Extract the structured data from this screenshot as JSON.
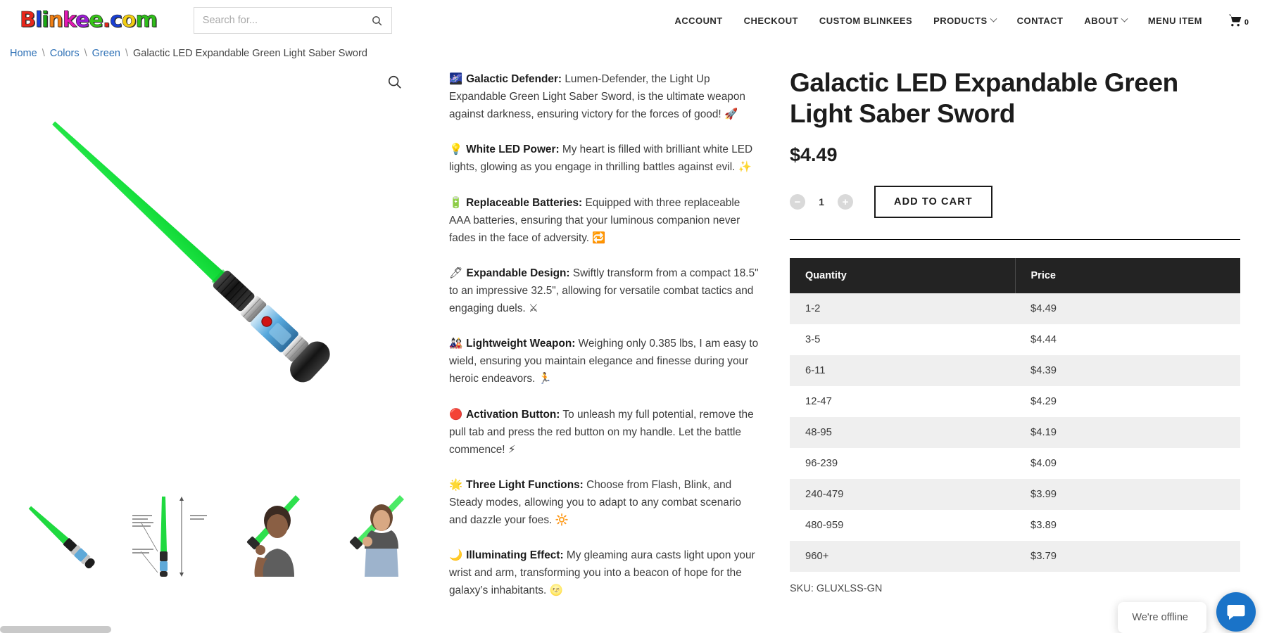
{
  "brand": {
    "name": "Blinkee.com",
    "letters": [
      {
        "ch": "B",
        "color": "#e8271c"
      },
      {
        "ch": "l",
        "color": "#1a3fd4"
      },
      {
        "ch": "i",
        "color": "#1aa814"
      },
      {
        "ch": "n",
        "color": "#f07f14"
      },
      {
        "ch": "k",
        "color": "#e318b4"
      },
      {
        "ch": "e",
        "color": "#9b1ad4"
      },
      {
        "ch": "e",
        "color": "#36c417"
      },
      {
        "ch": ".",
        "color": "#e8271c"
      },
      {
        "ch": "c",
        "color": "#1a3fd4"
      },
      {
        "ch": "o",
        "color": "#f2cd12"
      },
      {
        "ch": "m",
        "color": "#2fbe1a"
      }
    ]
  },
  "search": {
    "placeholder": "Search for...",
    "value": "",
    "icon": "search-icon"
  },
  "nav": {
    "items": [
      {
        "label": "ACCOUNT",
        "has_dropdown": false
      },
      {
        "label": "CHECKOUT",
        "has_dropdown": false
      },
      {
        "label": "CUSTOM BLINKEES",
        "has_dropdown": false
      },
      {
        "label": "PRODUCTS",
        "has_dropdown": true
      },
      {
        "label": "CONTACT",
        "has_dropdown": false
      },
      {
        "label": "ABOUT",
        "has_dropdown": true
      },
      {
        "label": "MENU ITEM",
        "has_dropdown": false
      }
    ],
    "cart": {
      "icon": "shopping-cart-icon",
      "count": "0"
    }
  },
  "breadcrumb": {
    "items": [
      "Home",
      "Colors",
      "Green"
    ],
    "separator": "\\",
    "current": "Galactic LED Expandable Green Light Saber Sword"
  },
  "gallery": {
    "zoom_icon": "magnifier-icon",
    "main_alt": "Green light saber sword with black and silver handle",
    "thumbnails": [
      {
        "alt": "Green light saber sword diagonal"
      },
      {
        "alt": "Light saber dimension diagram with measurements"
      },
      {
        "alt": "Boy holding green light saber"
      },
      {
        "alt": "Girl holding green light saber"
      }
    ]
  },
  "description": {
    "paragraphs": [
      {
        "emoji": "🌌",
        "heading": "Galactic Defender:",
        "text": " Lumen-Defender, the Light Up Expandable Green Light Saber Sword, is the ultimate weapon against darkness, ensuring victory for the forces of good! ",
        "trailing_emoji": "🚀"
      },
      {
        "emoji": "💡",
        "heading": "White LED Power:",
        "text": " My heart is filled with brilliant white LED lights, glowing as you engage in thrilling battles against evil. ",
        "trailing_emoji": "✨"
      },
      {
        "emoji": "🔋",
        "heading": "Replaceable Batteries:",
        "text": " Equipped with three replaceable AAA batteries, ensuring that your luminous companion never fades in the face of adversity. ",
        "trailing_emoji": "🔁"
      },
      {
        "emoji": "🖊",
        "heading": "Expandable Design:",
        "text": " Swiftly transform from a compact 18.5\" to an impressive 32.5\", allowing for versatile combat tactics and engaging duels. ",
        "trailing_emoji": "⚔"
      },
      {
        "emoji": "🎎",
        "heading": "Lightweight Weapon:",
        "text": " Weighing only 0.385 lbs, I am easy to wield, ensuring you maintain elegance and finesse during your heroic endeavors. ",
        "trailing_emoji": "🏃"
      },
      {
        "emoji": "🔴",
        "heading": "Activation Button:",
        "text": " To unleash my full potential, remove the pull tab and press the red button on my handle. Let the battle commence! ",
        "trailing_emoji": "⚡"
      },
      {
        "emoji": "🌟",
        "heading": "Three Light Functions:",
        "text": " Choose from Flash, Blink, and Steady modes, allowing you to adapt to any combat scenario and dazzle your foes. ",
        "trailing_emoji": "🔆"
      },
      {
        "emoji": "🌙",
        "heading": "Illuminating Effect:",
        "text": " My gleaming aura casts light upon your wrist and arm, transforming you into a beacon of hope for the galaxy’s inhabitants. ",
        "trailing_emoji": "🌝"
      }
    ]
  },
  "product": {
    "title": "Galactic LED Expandable Green Light Saber Sword",
    "price": "$4.49",
    "quantity_value": "1",
    "decrease_label": "−",
    "increase_label": "+",
    "add_to_cart_label": "ADD TO CART",
    "sku": "SKU: GLUXLSS-GN"
  },
  "tier_table": {
    "headers": [
      "Quantity",
      "Price"
    ],
    "rows": [
      {
        "quantity": "1-2",
        "price": "$4.49"
      },
      {
        "quantity": "3-5",
        "price": "$4.44"
      },
      {
        "quantity": "6-11",
        "price": "$4.39"
      },
      {
        "quantity": "12-47",
        "price": "$4.29"
      },
      {
        "quantity": "48-95",
        "price": "$4.19"
      },
      {
        "quantity": "96-239",
        "price": "$4.09"
      },
      {
        "quantity": "240-479",
        "price": "$3.99"
      },
      {
        "quantity": "480-959",
        "price": "$3.89"
      },
      {
        "quantity": "960+",
        "price": "$3.79"
      }
    ]
  },
  "chat": {
    "status_text": "We're offline",
    "fab_icon": "chat-message-icon",
    "fab_color": "#1a73c8"
  }
}
